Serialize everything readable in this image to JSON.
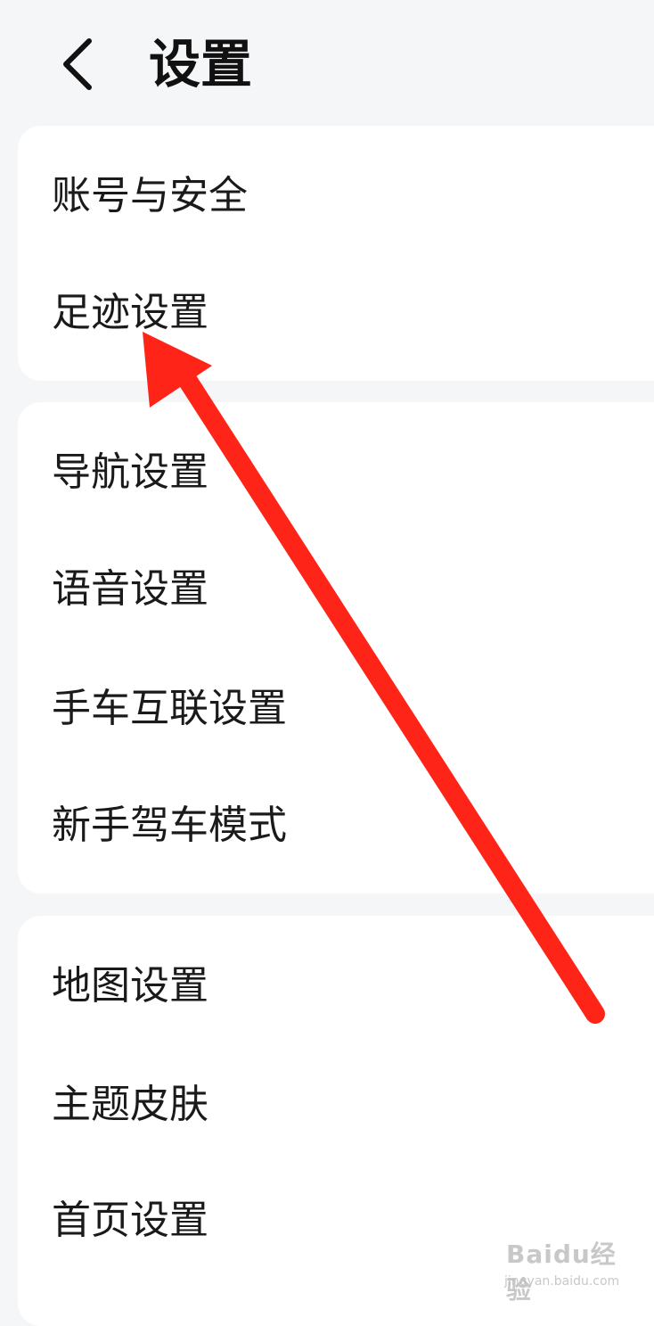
{
  "header": {
    "title": "设置",
    "back_icon": "chevron-left-icon"
  },
  "groups": [
    {
      "items": [
        {
          "label": "账号与安全"
        },
        {
          "label": "足迹设置"
        }
      ]
    },
    {
      "items": [
        {
          "label": "导航设置"
        },
        {
          "label": "语音设置"
        },
        {
          "label": "手车互联设置"
        },
        {
          "label": "新手驾车模式"
        }
      ]
    },
    {
      "items": [
        {
          "label": "地图设置"
        },
        {
          "label": "主题皮肤"
        },
        {
          "label": "首页设置"
        }
      ]
    }
  ],
  "annotation": {
    "arrow_color": "#ff2418",
    "points_to": "足迹设置"
  },
  "watermark": {
    "brand": "Baidu经验",
    "url": "jingyan.baidu.com"
  },
  "colors": {
    "background": "#f5f6f8",
    "card": "#ffffff",
    "text": "#1a1a1a"
  }
}
